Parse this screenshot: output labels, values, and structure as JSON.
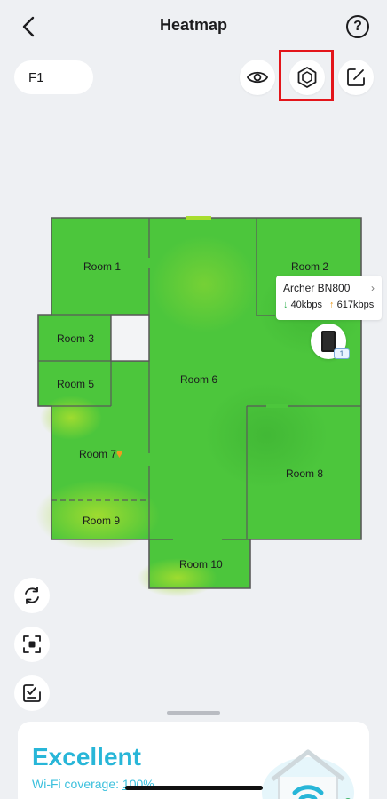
{
  "header": {
    "title": "Heatmap",
    "help_label": "?"
  },
  "floor": {
    "label": "F1"
  },
  "rooms": [
    {
      "label": "Room 1"
    },
    {
      "label": "Room 2"
    },
    {
      "label": "Room 3"
    },
    {
      "label": "Room 5"
    },
    {
      "label": "Room 6"
    },
    {
      "label": "Room 7"
    },
    {
      "label": "Room 8"
    },
    {
      "label": "Room 9"
    },
    {
      "label": "Room 10"
    }
  ],
  "device": {
    "name": "Archer BN800",
    "download": "40kbps",
    "upload": "617kbps",
    "badge": "1",
    "download_arrow": "↓",
    "upload_arrow": "↑",
    "chevron": "›"
  },
  "coverage": {
    "rating": "Excellent",
    "label": "Wi-Fi coverage: ",
    "value": "100%"
  },
  "colors": {
    "heat_green": "#4cc63c",
    "heat_yellow": "#a6dc2c",
    "accent": "#28b6d8",
    "highlight": "#e3151a"
  }
}
